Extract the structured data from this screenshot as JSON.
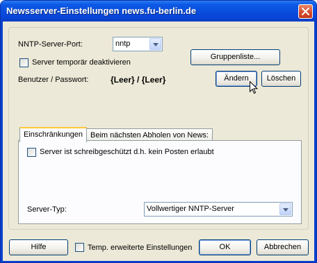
{
  "window": {
    "title": "Newsserver-Einstellungen news.fu-berlin.de"
  },
  "settings": {
    "port_label": "NNTP-Server-Port:",
    "port_value": "nntp",
    "disable_label": "Server temporär deaktivieren",
    "disable_checked": false,
    "grouplist_button": "Gruppenliste...",
    "credentials_label": "Benutzer / Passwort:",
    "credentials_value": "{Leer} / {Leer}",
    "change_button": "Ändern",
    "delete_button": "Löschen"
  },
  "tabs": [
    {
      "label": "Einschränkungen",
      "active": true
    },
    {
      "label": "Beim nächsten Abholen von News:",
      "active": false
    }
  ],
  "restrictions": {
    "readonly_label": "Server ist schreibgeschützt d.h. kein Posten erlaubt",
    "readonly_checked": false,
    "server_type_label": "Server-Typ:",
    "server_type_value": "Vollwertiger NNTP-Server"
  },
  "footer": {
    "help_button": "Hilfe",
    "advanced_label": "Temp. erweiterte Einstellungen",
    "advanced_checked": false,
    "ok_button": "OK",
    "cancel_button": "Abbrechen"
  },
  "icons": [
    "close-icon",
    "dropdown-arrow-icon",
    "mouse-cursor-icon"
  ],
  "colors": {
    "titlebar": "#0a4ede",
    "dialog_bg": "#ece9d8",
    "close_button": "#d5472a",
    "tab_highlight": "#ffc83c"
  }
}
